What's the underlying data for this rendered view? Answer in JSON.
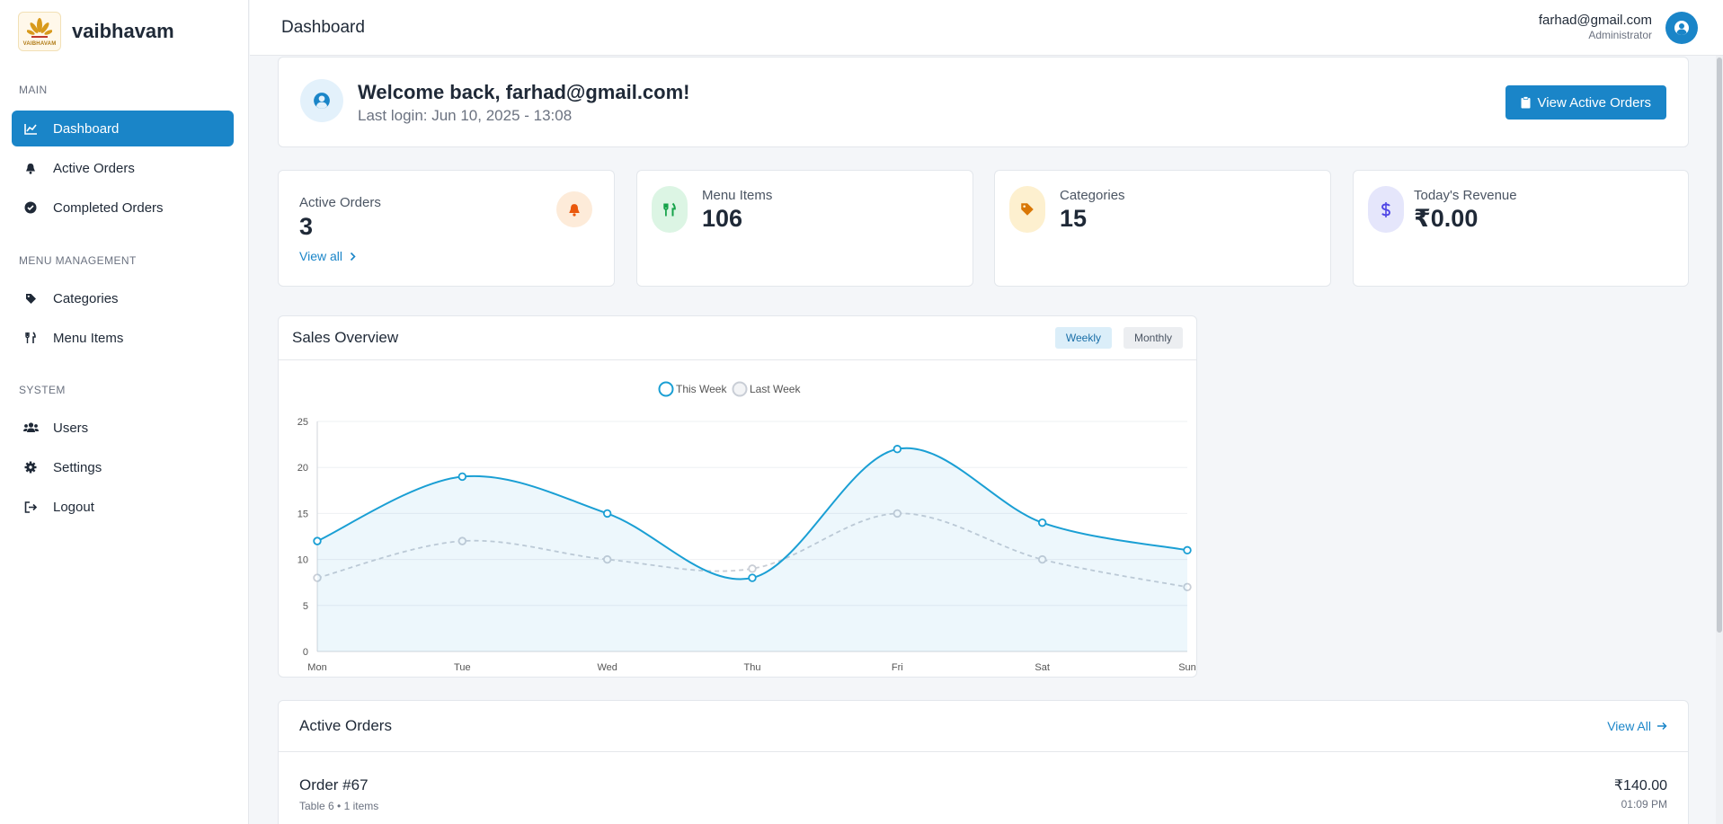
{
  "brand": {
    "name": "vaibhavam",
    "logo_text": "VAIBHAVAM"
  },
  "sidebar": {
    "sections": [
      {
        "title": "MAIN",
        "items": [
          {
            "label": "Dashboard",
            "icon": "chart-line-icon",
            "active": true
          },
          {
            "label": "Active Orders",
            "icon": "bell-icon"
          },
          {
            "label": "Completed Orders",
            "icon": "check-circle-icon"
          }
        ]
      },
      {
        "title": "MENU MANAGEMENT",
        "items": [
          {
            "label": "Categories",
            "icon": "tag-icon"
          },
          {
            "label": "Menu Items",
            "icon": "utensils-icon"
          }
        ]
      },
      {
        "title": "SYSTEM",
        "items": [
          {
            "label": "Users",
            "icon": "users-icon"
          },
          {
            "label": "Settings",
            "icon": "gear-icon"
          },
          {
            "label": "Logout",
            "icon": "logout-icon"
          }
        ]
      }
    ]
  },
  "header": {
    "title": "Dashboard",
    "user_email": "farhad@gmail.com",
    "user_role": "Administrator"
  },
  "welcome": {
    "title": "Welcome back, farhad@gmail.com!",
    "last_login": "Last login: Jun 10, 2025 - 13:08",
    "button_label": "View Active Orders"
  },
  "stats": {
    "active_orders": {
      "label": "Active Orders",
      "value": "3",
      "link": "View all",
      "color": "#ea580c"
    },
    "menu_items": {
      "label": "Menu Items",
      "value": "106",
      "color": "#16a34a"
    },
    "categories": {
      "label": "Categories",
      "value": "15",
      "color": "#d97706"
    },
    "revenue": {
      "label": "Today's Revenue",
      "value": "₹0.00",
      "color": "#4f46e5"
    }
  },
  "sales": {
    "title": "Sales Overview",
    "toggle_weekly": "Weekly",
    "toggle_monthly": "Monthly"
  },
  "chart_data": {
    "type": "line",
    "categories": [
      "Mon",
      "Tue",
      "Wed",
      "Thu",
      "Fri",
      "Sat",
      "Sun"
    ],
    "series": [
      {
        "name": "This Week",
        "values": [
          12,
          19,
          15,
          8,
          22,
          14,
          11
        ],
        "color": "#1a9fd4",
        "fill": true
      },
      {
        "name": "Last Week",
        "values": [
          8,
          12,
          10,
          9,
          15,
          10,
          7
        ],
        "color": "#c9ced6",
        "dashed": true
      }
    ],
    "ylim": [
      0,
      25
    ],
    "yticks": [
      0,
      5,
      10,
      15,
      20,
      25
    ],
    "legend": "top",
    "grid": true
  },
  "active_orders_panel": {
    "title": "Active Orders",
    "view_all": "View All",
    "orders": [
      {
        "title": "Order #67",
        "meta": "Table 6 • 1 items",
        "amount": "₹140.00",
        "time": "01:09 PM"
      }
    ]
  }
}
